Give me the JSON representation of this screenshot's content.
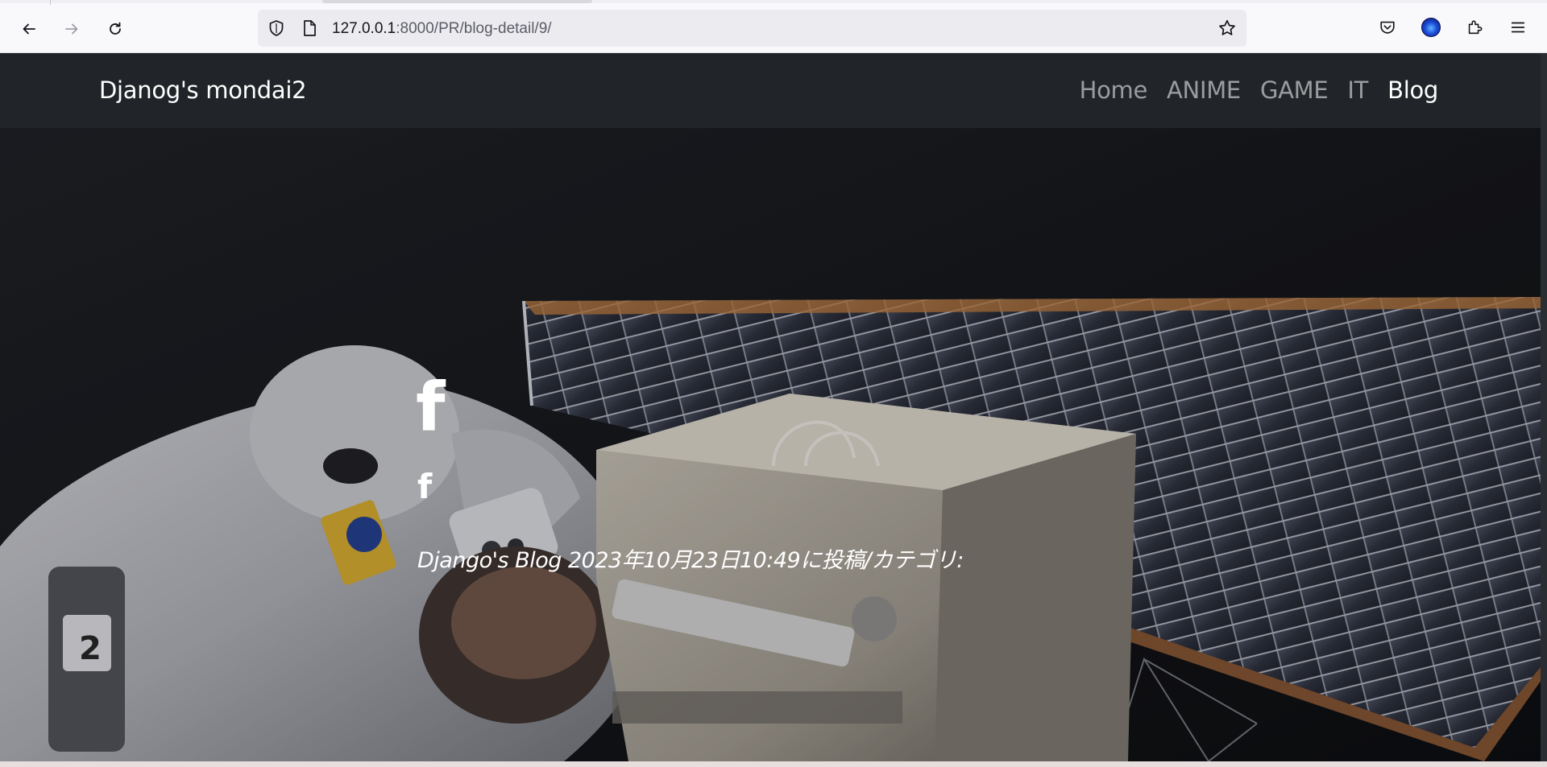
{
  "browser": {
    "url_host": "127.0.0.1",
    "url_rest": ":8000/PR/blog-detail/9/",
    "icons": [
      "back-arrow-icon",
      "forward-arrow-icon",
      "reload-icon",
      "shield-icon",
      "page-icon",
      "bookmark-star-icon",
      "pocket-icon",
      "profile-avatar-icon",
      "extensions-icon",
      "menu-icon"
    ]
  },
  "navbar": {
    "brand": "Djanog's mondai2",
    "links": [
      {
        "label": "Home",
        "active": false
      },
      {
        "label": "ANIME",
        "active": false
      },
      {
        "label": "GAME",
        "active": false
      },
      {
        "label": "IT",
        "active": false
      },
      {
        "label": "Blog",
        "active": true
      }
    ]
  },
  "hero": {
    "icon_large": "f",
    "icon_small": "f",
    "meta_text": "Django's Blog 2023年10月23日10:49に投稿/カテゴリ:"
  },
  "colors": {
    "navbar_bg": "#212529",
    "nav_link": "rgba(255,255,255,0.55)",
    "nav_link_active": "#ffffff"
  }
}
